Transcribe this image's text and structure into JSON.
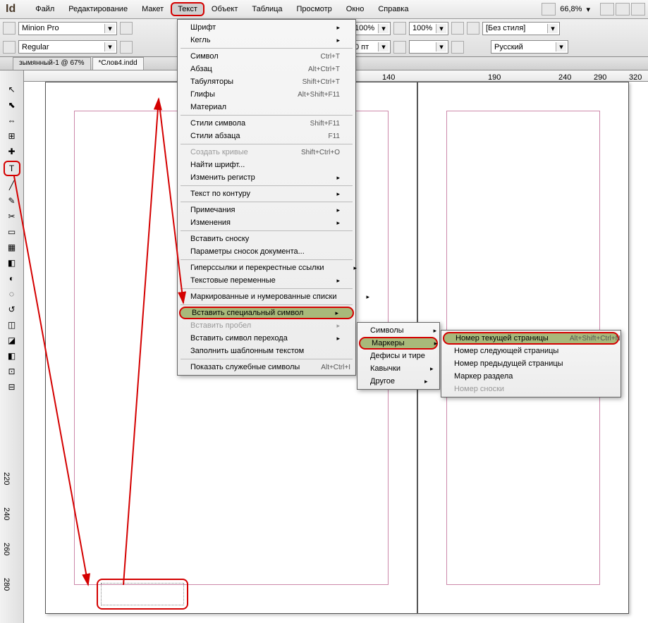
{
  "app": {
    "logo": "Id"
  },
  "menubar": [
    "Файл",
    "Редактирование",
    "Макет",
    "Текст",
    "Объект",
    "Таблица",
    "Просмотр",
    "Окно",
    "Справка"
  ],
  "zoom": "66,8%",
  "control": {
    "font": "Minion Pro",
    "style": "Regular",
    "scaleH": "100%",
    "scaleV": "100%",
    "leading": "0 пт",
    "charStyle": "[Без стиля]",
    "lang": "Русский"
  },
  "tabs": [
    "зымянный-1 @ 67%",
    "*Слов4.indd"
  ],
  "ruler_marks": [
    140,
    190,
    240,
    290,
    320
  ],
  "ruler_v": [
    "220",
    "240",
    "260",
    "280"
  ],
  "menu1": [
    {
      "l": "Шрифт",
      "sub": true
    },
    {
      "l": "Кегль",
      "sub": true
    },
    {
      "sep": true
    },
    {
      "l": "Символ",
      "s": "Ctrl+T"
    },
    {
      "l": "Абзац",
      "s": "Alt+Ctrl+T"
    },
    {
      "l": "Табуляторы",
      "s": "Shift+Ctrl+T"
    },
    {
      "l": "Глифы",
      "s": "Alt+Shift+F11"
    },
    {
      "l": "Материал"
    },
    {
      "sep": true
    },
    {
      "l": "Стили символа",
      "s": "Shift+F11"
    },
    {
      "l": "Стили абзаца",
      "s": "F11"
    },
    {
      "sep": true
    },
    {
      "l": "Создать кривые",
      "s": "Shift+Ctrl+O",
      "dim": true
    },
    {
      "l": "Найти шрифт..."
    },
    {
      "l": "Изменить регистр",
      "sub": true
    },
    {
      "sep": true
    },
    {
      "l": "Текст по контуру",
      "sub": true
    },
    {
      "sep": true
    },
    {
      "l": "Примечания",
      "sub": true
    },
    {
      "l": "Изменения",
      "sub": true
    },
    {
      "sep": true
    },
    {
      "l": "Вставить сноску"
    },
    {
      "l": "Параметры сносок документа..."
    },
    {
      "sep": true
    },
    {
      "l": "Гиперссылки и перекрестные ссылки",
      "sub": true
    },
    {
      "l": "Текстовые переменные",
      "sub": true
    },
    {
      "sep": true
    },
    {
      "l": "Маркированные и нумерованные списки",
      "sub": true
    },
    {
      "sep": true
    },
    {
      "l": "Вставить специальный символ",
      "sub": true,
      "hl": true
    },
    {
      "l": "Вставить пробел",
      "sub": true,
      "dim": true
    },
    {
      "l": "Вставить символ перехода",
      "sub": true
    },
    {
      "l": "Заполнить шаблонным текстом"
    },
    {
      "sep": true
    },
    {
      "l": "Показать служебные символы",
      "s": "Alt+Ctrl+I"
    }
  ],
  "menu2": [
    {
      "l": "Символы",
      "sub": true
    },
    {
      "l": "Маркеры",
      "sub": true,
      "hl": true
    },
    {
      "l": "Дефисы и тире",
      "sub": true
    },
    {
      "l": "Кавычки",
      "sub": true
    },
    {
      "l": "Другое",
      "sub": true
    }
  ],
  "menu3": [
    {
      "l": "Номер текущей страницы",
      "s": "Alt+Shift+Ctrl+N",
      "hl": true
    },
    {
      "l": "Номер следующей страницы"
    },
    {
      "l": "Номер предыдущей страницы"
    },
    {
      "l": "Маркер раздела"
    },
    {
      "l": "Номер сноски",
      "dim": true
    }
  ],
  "tool_glyphs": [
    "↖",
    "⬉",
    "⇔",
    "⊞",
    "✚",
    "T",
    "╱",
    "✎",
    "✂",
    "▭",
    "▦",
    "◧",
    "◐",
    "◌",
    "↺",
    "◫",
    "◪",
    "◧",
    "⊡",
    "⊟"
  ]
}
